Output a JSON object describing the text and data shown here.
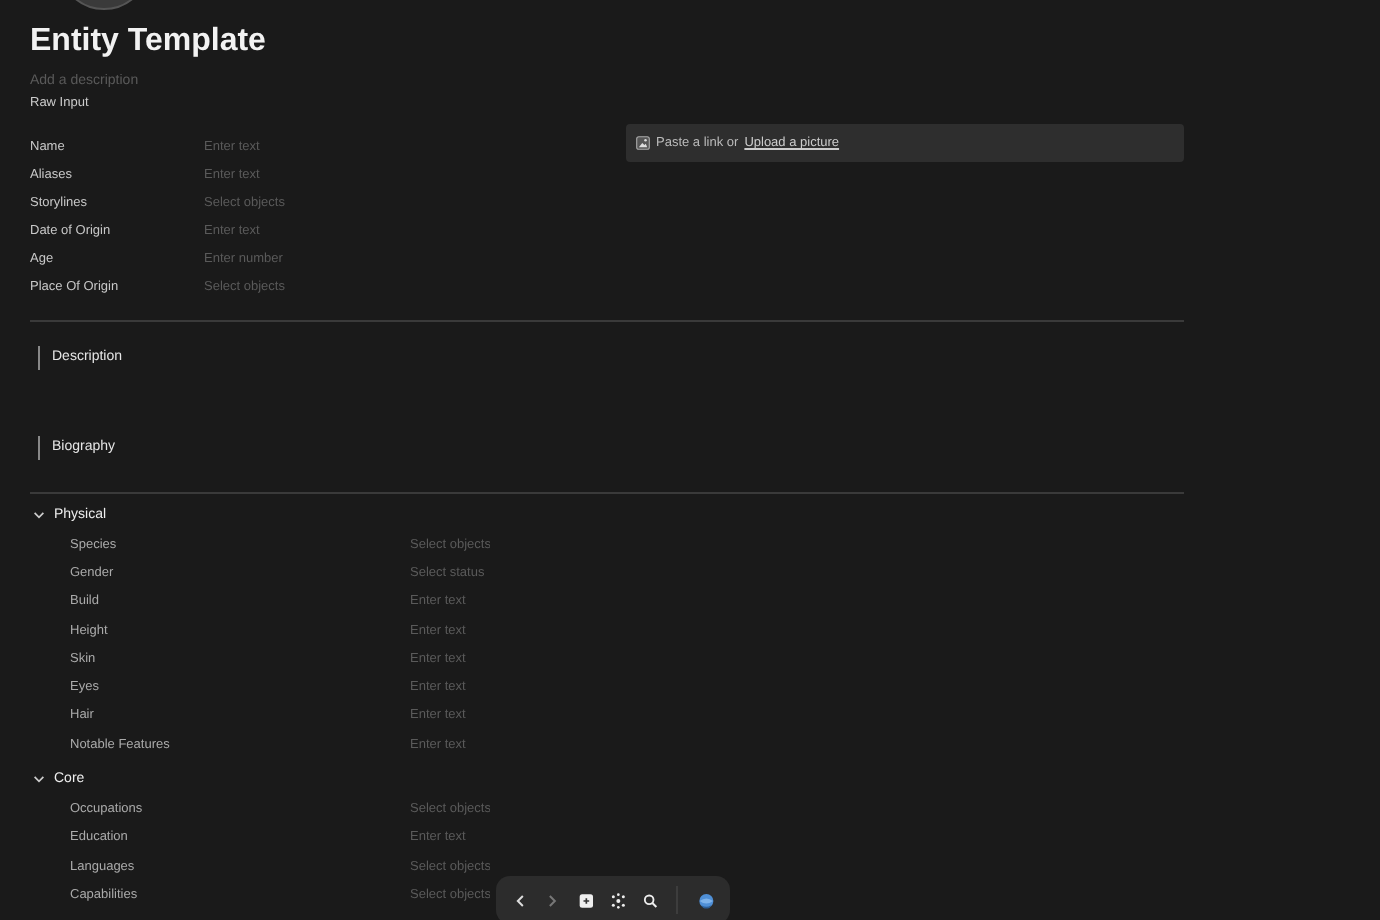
{
  "title": "Entity Template",
  "description": {
    "placeholder": "Add a description"
  },
  "raw_input": "Raw Input",
  "properties": [
    {
      "label": "Name",
      "placeholder": "Enter text"
    },
    {
      "label": "Aliases",
      "placeholder": "Enter text"
    },
    {
      "label": "Storylines",
      "placeholder": "Select objects"
    },
    {
      "label": "Date of Origin",
      "placeholder": "Enter text"
    },
    {
      "label": "Age",
      "placeholder": "Enter number"
    },
    {
      "label": "Place Of Origin",
      "placeholder": "Select objects"
    }
  ],
  "cover": {
    "text": "Paste a link or",
    "link": "Upload a picture"
  },
  "text_sections": [
    {
      "heading": "Description"
    },
    {
      "heading": "Biography"
    }
  ],
  "groups": [
    {
      "title": "Physical",
      "expanded": true,
      "fields": [
        {
          "label": "Species",
          "placeholder": "Select objects"
        },
        {
          "label": "Gender",
          "placeholder": "Select status"
        },
        {
          "label": "Build",
          "placeholder": "Enter text"
        },
        {
          "label": "Height",
          "placeholder": "Enter text"
        },
        {
          "label": "Skin",
          "placeholder": "Enter text"
        },
        {
          "label": "Eyes",
          "placeholder": "Enter text"
        },
        {
          "label": "Hair",
          "placeholder": "Enter text"
        },
        {
          "label": "Notable Features",
          "placeholder": "Enter text"
        }
      ]
    },
    {
      "title": "Core",
      "expanded": true,
      "fields": [
        {
          "label": "Occupations",
          "placeholder": "Select objects"
        },
        {
          "label": "Education",
          "placeholder": "Enter text"
        },
        {
          "label": "Languages",
          "placeholder": "Select objects"
        },
        {
          "label": "Capabilities",
          "placeholder": "Select objects"
        }
      ]
    }
  ]
}
